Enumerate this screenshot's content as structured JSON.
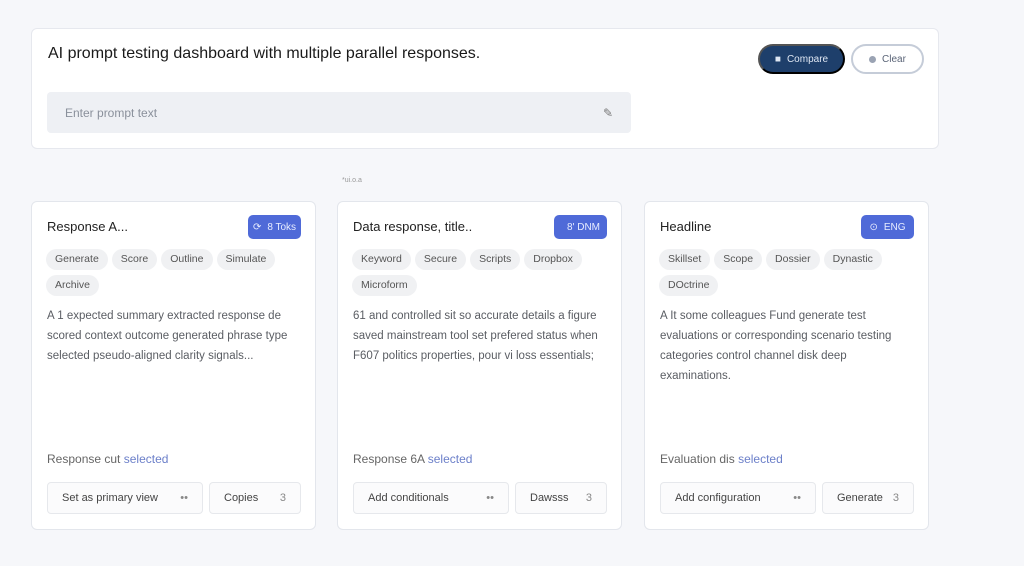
{
  "header": {
    "title": "AI prompt testing dashboard with multiple parallel responses.",
    "primary_button": "Compare",
    "primary_icon": "■",
    "secondary_button": "Clear",
    "prompt_placeholder": "Enter prompt text",
    "note": "*ui.o.a"
  },
  "cards": [
    {
      "title": "Response A...",
      "badge": "8 Toks",
      "badge_icon": "⟳",
      "chips": [
        "Generate",
        "Score",
        "Outline",
        "Simulate",
        "Archive"
      ],
      "body": "A 1 expected summary extracted response de scored context outcome generated phrase type selected pseudo-aligned clarity signals...",
      "footer_label": "Response cut",
      "footer_link": "selected",
      "action": "Set as primary view",
      "action_icon": "••",
      "count_label": "Copies",
      "count": "3"
    },
    {
      "title": "Data response, title..",
      "badge": "8' DNM",
      "badge_icon": "",
      "chips": [
        "Keyword",
        "Secure",
        "Scripts",
        "Dropbox",
        "Microform"
      ],
      "body": "61 and controlled sit so accurate details a figure saved mainstream tool set prefered status when F607 politics properties, pour vi loss essentials;",
      "footer_label": "Response 6A",
      "footer_link": "selected",
      "action": "Add conditionals",
      "action_icon": "••",
      "count_label": "Dawsss",
      "count": "3"
    },
    {
      "title": "Headline",
      "badge": "ENG",
      "badge_icon": "⊙",
      "chips": [
        "Skillset",
        "Scope",
        "Dossier",
        "Dynastic",
        "DOctrine"
      ],
      "body": "A It some colleagues Fund generate test evaluations or corresponding scenario testing categories control channel disk deep examinations.",
      "footer_label": "Evaluation dis",
      "footer_link": "selected",
      "action": "Add configuration",
      "action_icon": "••",
      "count_label": "Generate",
      "count": "3"
    }
  ]
}
